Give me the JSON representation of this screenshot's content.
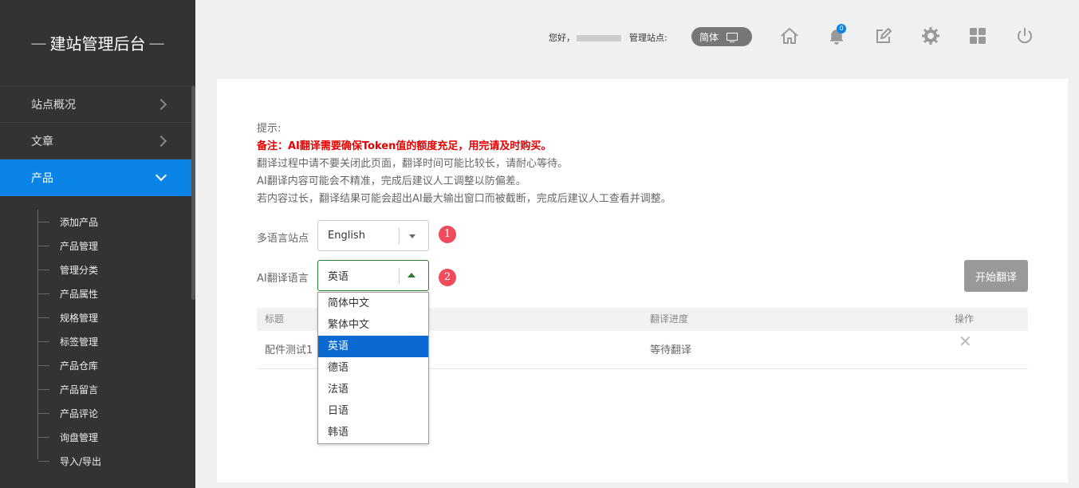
{
  "sidebar": {
    "title": "建站管理后台",
    "nav": [
      {
        "label": "站点概况"
      },
      {
        "label": "文章"
      },
      {
        "label": "产品"
      }
    ],
    "sub_items": [
      {
        "label": "添加产品"
      },
      {
        "label": "产品管理"
      },
      {
        "label": "管理分类"
      },
      {
        "label": "产品属性"
      },
      {
        "label": "规格管理"
      },
      {
        "label": "标签管理"
      },
      {
        "label": "产品仓库"
      },
      {
        "label": "产品留言"
      },
      {
        "label": "产品评论"
      },
      {
        "label": "询盘管理"
      },
      {
        "label": "导入/导出"
      }
    ]
  },
  "header": {
    "greeting": "您好，",
    "site_label": "管理站点:",
    "lang_pill": "简体",
    "notification_count": "0",
    "icons": [
      "home-icon",
      "bell-icon",
      "edit-icon",
      "gear-icon",
      "grid-icon",
      "power-icon"
    ]
  },
  "tips": {
    "title": "提示:",
    "warning": "备注：AI翻译需要确保Token值的额度充足，用完请及时购买。",
    "lines": [
      "翻译过程中请不要关闭此页面，翻译时间可能比较长，请耐心等待。",
      "AI翻译内容可能会不精准，完成后建议人工调整以防偏差。",
      "若内容过长，翻译结果可能会超出AI最大输出窗口而被截断，完成后建议人工查看并调整。"
    ]
  },
  "form": {
    "site_label": "多语言站点",
    "site_value": "English",
    "step1": "1",
    "lang_label": "AI翻译语言",
    "lang_value": "英语",
    "step2": "2",
    "start_button": "开始翻译"
  },
  "dropdown": {
    "options": [
      "简体中文",
      "繁体中文",
      "英语",
      "德语",
      "法语",
      "日语",
      "韩语"
    ],
    "selected": "英语"
  },
  "table": {
    "headers": {
      "title": "标题",
      "progress": "翻译进度",
      "action": "操作"
    },
    "rows": [
      {
        "title": "配件测试1",
        "progress": "等待翻译"
      }
    ]
  },
  "colors": {
    "sidebar_bg": "#333333",
    "accent": "#0a84e6",
    "warning": "#e60000",
    "step_badge": "#f04b5b"
  }
}
